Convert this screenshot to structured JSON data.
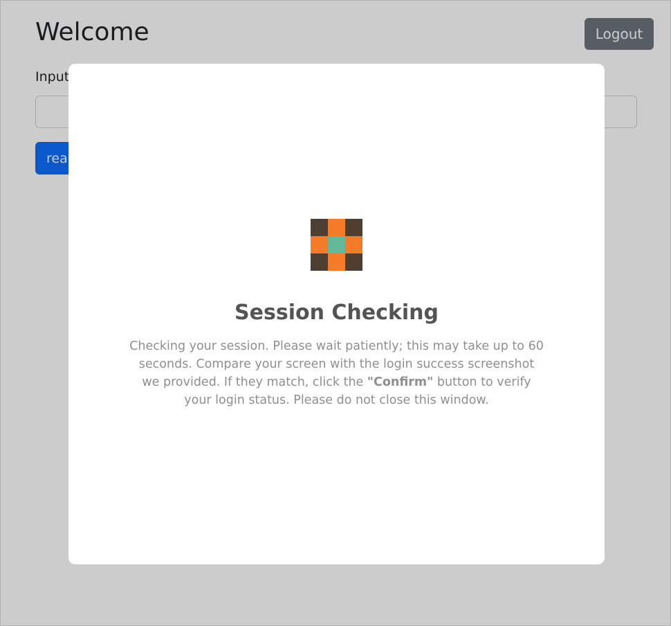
{
  "header": {
    "title": "Welcome",
    "logout_label": "Logout"
  },
  "form": {
    "input_label": "Input",
    "input_value": "",
    "read_button_label": "read"
  },
  "modal": {
    "logo_icon": "checkered-tile-icon",
    "logo_colors": [
      "#4f3f33",
      "#f47b27",
      "#63b899"
    ],
    "title": "Session Checking",
    "body_part1": "Checking your session. Please wait patiently; this may take up to 60 seconds. Compare your screen with the login success screenshot we provided. If they match, click the ",
    "body_bold": "\"Confirm\"",
    "body_part2": " button to verify your login status. Please do not close this window."
  },
  "colors": {
    "overlay": "rgba(0,0,0,0.2)",
    "logout_button": "#6c757d",
    "primary_button": "#0d6efd"
  }
}
